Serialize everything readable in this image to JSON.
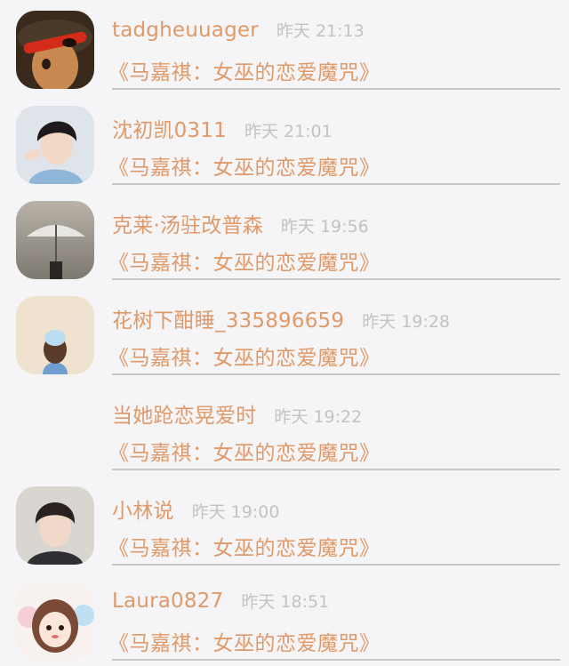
{
  "feed": {
    "items": [
      {
        "username": "tadgheuuager",
        "time": "昨天 21:13",
        "title": "《马嘉祺：女巫的恋爱魔咒》",
        "avatar": "pirate-doll-avatar"
      },
      {
        "username": "沈初凯0311",
        "time": "昨天 21:01",
        "title": "《马嘉祺：女巫的恋爱魔咒》",
        "avatar": "boy-portrait-avatar"
      },
      {
        "username": "克莱·汤驻改普森",
        "time": "昨天 19:56",
        "title": "《马嘉祺：女巫的恋爱魔咒》",
        "avatar": "umbrella-avatar"
      },
      {
        "username": "花树下酣睡_335896659",
        "time": "昨天 19:28",
        "title": "《马嘉祺：女巫的恋爱魔咒》",
        "avatar": "girl-back-avatar"
      },
      {
        "username": "当她跄恋晃爱时",
        "time": "昨天 19:22",
        "title": "《马嘉祺：女巫的恋爱魔咒》",
        "avatar": "none"
      },
      {
        "username": "小林说",
        "time": "昨天 19:00",
        "title": "《马嘉祺：女巫的恋爱魔咒》",
        "avatar": "boy-portrait-avatar-2"
      },
      {
        "username": "Laura0827",
        "time": "昨天 18:51",
        "title": "《马嘉祺：女巫的恋爱魔咒》",
        "avatar": "cartoon-girl-avatar"
      }
    ]
  }
}
